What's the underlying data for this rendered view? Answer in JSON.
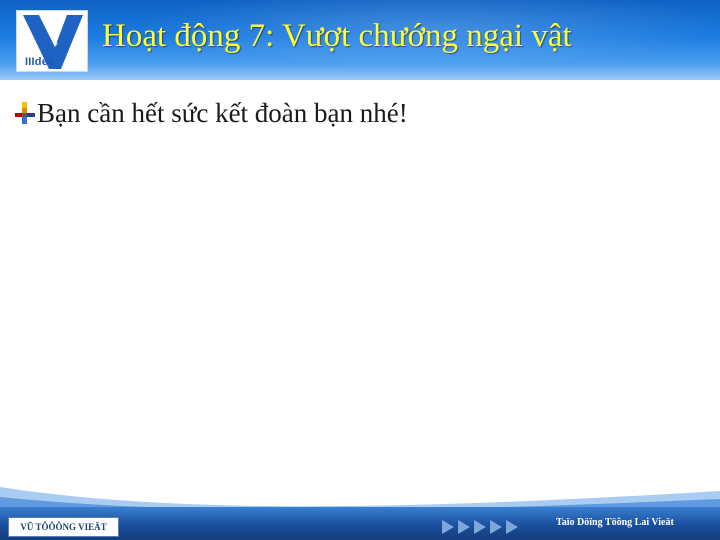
{
  "slide": {
    "logo": {
      "icon": "v-idea-logo",
      "word": "IIIdea"
    },
    "title": "Hoạt động 7: Vượt chướng ngại vật",
    "bullets": [
      {
        "icon": "bullet-cross-icon",
        "text": "Bạn cần hết sức kết đoàn bạn nhé!"
      }
    ]
  },
  "footer": {
    "left_label": "VŨ TÔÔÔNG VIEÄT",
    "nav_icon": "forward-arrows-icon",
    "right_label": "Taïo Döïng Töông Lai Vieät"
  },
  "colors": {
    "header_blue": "#1b7be0",
    "title_yellow": "#ffff33",
    "footer_blue": "#1a4f9c"
  }
}
